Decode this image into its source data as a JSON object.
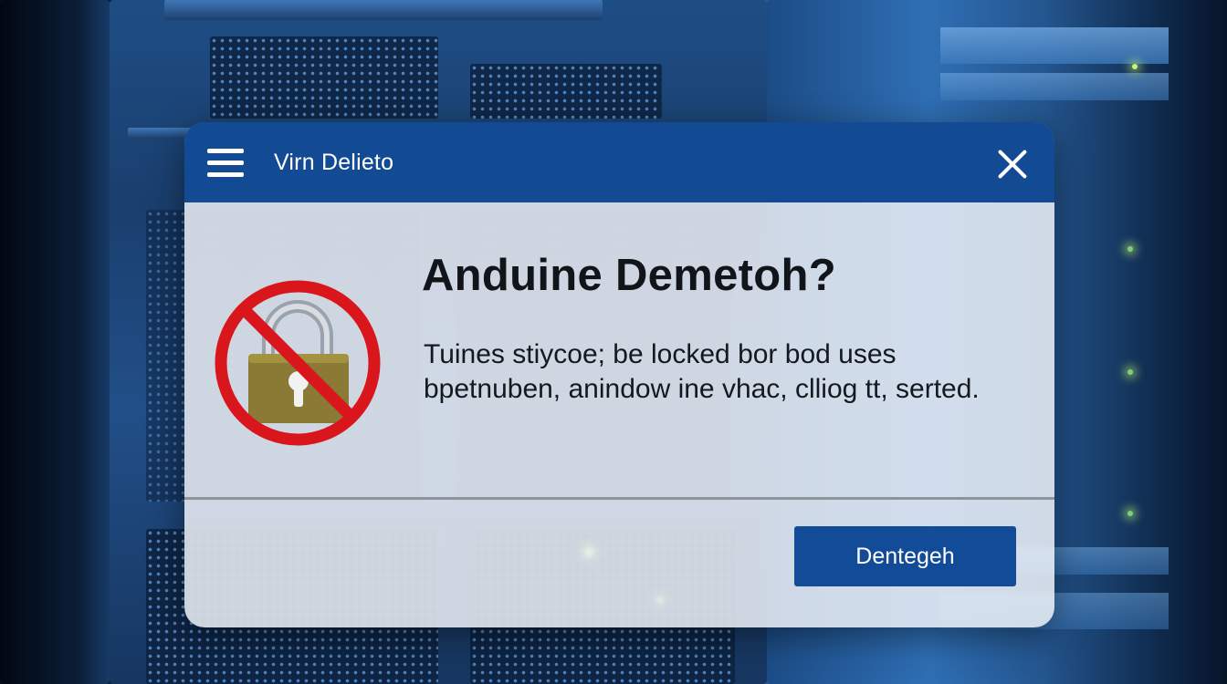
{
  "dialog": {
    "title": "Virn Delieto",
    "heading": "Anduine Demetoh?",
    "message": "Tuines stiycoe; be locked bor bod uses bpetnuben, anindow ine vhac, clliog tt, serted.",
    "primary_button_label": "Dentegeh"
  },
  "icons": {
    "menu": "hamburger-menu-icon",
    "close": "close-icon",
    "status": "locked-prohibited-icon"
  },
  "colors": {
    "titlebar": "#134a94",
    "button": "#124c99",
    "prohibited_sign": "#d9161c",
    "lock_body": "#8a7a35"
  }
}
